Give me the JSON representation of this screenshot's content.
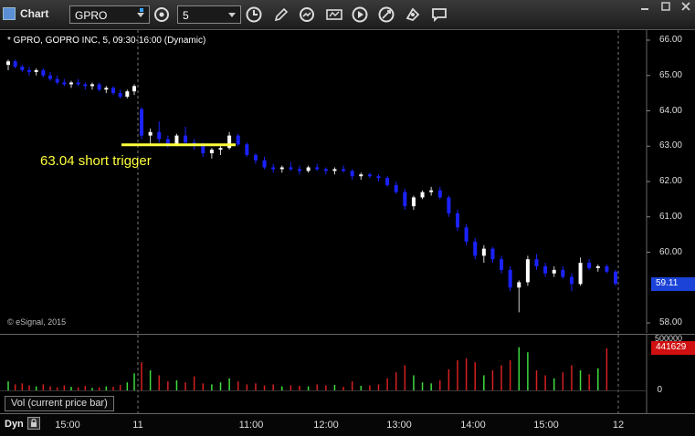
{
  "toolbar": {
    "title": "Chart",
    "symbol": "GPRO",
    "interval": "5",
    "icons": [
      "link-settings-icon",
      "time-icon",
      "draw-pencil-icon",
      "refresh-icon",
      "study-icon",
      "play-icon",
      "tools-icon",
      "shapes-icon",
      "comment-icon"
    ],
    "window_icons": [
      "minimize-icon",
      "maximize-icon",
      "close-icon"
    ]
  },
  "chart": {
    "header": "* GPRO, GOPRO INC, 5, 09:30-16:00 (Dynamic)",
    "annotation": "63.04 short trigger",
    "copyright": "© eSignal, 2015",
    "last_price": "59.11",
    "volume_label": "Vol (current price bar)",
    "last_volume": "441629",
    "volume_top_tick": "500000",
    "volume_zero_tick": "0",
    "dyn_label": "Dyn"
  },
  "colors": {
    "up_candle": "#ffffff",
    "down_candle": "#1a22ff",
    "annotation": "#ffff3c",
    "price_badge": "#1c43d8",
    "volume_badge": "#d01010",
    "volume_up": "#3fdc3f",
    "volume_down": "#d42020"
  },
  "chart_data": {
    "type": "candlestick",
    "title": "* GPRO, GOPRO INC, 5, 09:30-16:00 (Dynamic)",
    "y_ticks": [
      "66.00",
      "65.00",
      "64.00",
      "63.00",
      "62.00",
      "61.00",
      "60.00",
      "58.00"
    ],
    "y_tick_values": [
      66,
      65,
      64,
      63,
      62,
      61,
      60,
      58
    ],
    "ylim": [
      57.7,
      66.2
    ],
    "x_ticks": [
      "15:00",
      "11",
      "11:00",
      "12:00",
      "13:00",
      "14:00",
      "15:00",
      "12"
    ],
    "trigger_level": 63.04,
    "last_price": 59.11,
    "volume_ylim": [
      0,
      500000
    ],
    "grid": "dashed vertical day separators",
    "series": [
      {
        "candles": [
          [
            65.3,
            65.45,
            65.15,
            65.4
          ],
          [
            65.4,
            65.45,
            65.2,
            65.25
          ],
          [
            65.25,
            65.3,
            65.1,
            65.15
          ],
          [
            65.15,
            65.25,
            65.0,
            65.1
          ],
          [
            65.1,
            65.2,
            65.0,
            65.15
          ],
          [
            65.15,
            65.2,
            64.95,
            65.0
          ],
          [
            65.0,
            65.1,
            64.85,
            64.9
          ],
          [
            64.9,
            65.0,
            64.75,
            64.8
          ],
          [
            64.8,
            64.9,
            64.7,
            64.75
          ],
          [
            64.75,
            64.85,
            64.65,
            64.8
          ],
          [
            64.8,
            64.9,
            64.7,
            64.75
          ],
          [
            64.75,
            64.8,
            64.6,
            64.7
          ],
          [
            64.7,
            64.8,
            64.6,
            64.75
          ],
          [
            64.75,
            64.8,
            64.55,
            64.6
          ],
          [
            64.6,
            64.7,
            64.5,
            64.65
          ],
          [
            64.65,
            64.7,
            64.45,
            64.5
          ],
          [
            64.5,
            64.6,
            64.35,
            64.4
          ],
          [
            64.4,
            64.6,
            64.35,
            64.55
          ],
          [
            64.55,
            64.75,
            64.45,
            64.7
          ],
          [
            64.05,
            64.1,
            63.2,
            63.3
          ],
          [
            63.3,
            63.5,
            63.05,
            63.4
          ],
          [
            63.4,
            63.7,
            63.1,
            63.2
          ],
          [
            63.2,
            63.3,
            62.95,
            63.05
          ],
          [
            63.05,
            63.35,
            63.0,
            63.3
          ],
          [
            63.3,
            63.55,
            63.05,
            63.1
          ],
          [
            63.1,
            63.2,
            62.9,
            63.0
          ],
          [
            63.0,
            63.1,
            62.7,
            62.8
          ],
          [
            62.8,
            62.95,
            62.65,
            62.9
          ],
          [
            62.9,
            63.0,
            62.75,
            62.95
          ],
          [
            62.95,
            63.4,
            62.9,
            63.3
          ],
          [
            63.3,
            63.35,
            63.0,
            63.05
          ],
          [
            63.05,
            63.1,
            62.7,
            62.75
          ],
          [
            62.75,
            62.8,
            62.5,
            62.6
          ],
          [
            62.6,
            62.7,
            62.35,
            62.4
          ],
          [
            62.4,
            62.5,
            62.25,
            62.35
          ],
          [
            62.35,
            62.45,
            62.25,
            62.4
          ],
          [
            62.4,
            62.55,
            62.3,
            62.35
          ],
          [
            62.35,
            62.45,
            62.2,
            62.3
          ],
          [
            62.3,
            62.45,
            62.25,
            62.4
          ],
          [
            62.4,
            62.5,
            62.3,
            62.35
          ],
          [
            62.35,
            62.4,
            62.2,
            62.3
          ],
          [
            62.3,
            62.4,
            62.2,
            62.35
          ],
          [
            62.35,
            62.45,
            62.25,
            62.3
          ],
          [
            62.3,
            62.35,
            62.05,
            62.15
          ],
          [
            62.15,
            62.25,
            62.05,
            62.2
          ],
          [
            62.2,
            62.25,
            62.1,
            62.15
          ],
          [
            62.15,
            62.2,
            62.0,
            62.1
          ],
          [
            62.1,
            62.15,
            61.85,
            61.9
          ],
          [
            61.9,
            62.0,
            61.65,
            61.7
          ],
          [
            61.7,
            61.8,
            61.2,
            61.3
          ],
          [
            61.3,
            61.6,
            61.2,
            61.55
          ],
          [
            61.55,
            61.75,
            61.5,
            61.7
          ],
          [
            61.7,
            61.85,
            61.6,
            61.75
          ],
          [
            61.75,
            61.85,
            61.5,
            61.55
          ],
          [
            61.55,
            61.6,
            61.0,
            61.1
          ],
          [
            61.1,
            61.2,
            60.6,
            60.7
          ],
          [
            60.7,
            60.8,
            60.2,
            60.3
          ],
          [
            60.3,
            60.4,
            59.8,
            59.9
          ],
          [
            59.9,
            60.2,
            59.7,
            60.1
          ],
          [
            60.1,
            60.15,
            59.7,
            59.8
          ],
          [
            59.8,
            59.9,
            59.4,
            59.5
          ],
          [
            59.5,
            59.6,
            58.9,
            59.0
          ],
          [
            59.0,
            59.2,
            58.3,
            59.15
          ],
          [
            59.15,
            59.9,
            59.05,
            59.8
          ],
          [
            59.8,
            59.95,
            59.5,
            59.6
          ],
          [
            59.6,
            59.7,
            59.3,
            59.4
          ],
          [
            59.4,
            59.6,
            59.3,
            59.5
          ],
          [
            59.5,
            59.6,
            59.25,
            59.3
          ],
          [
            59.3,
            59.4,
            58.9,
            59.1
          ],
          [
            59.1,
            59.85,
            59.05,
            59.7
          ],
          [
            59.7,
            59.8,
            59.5,
            59.55
          ],
          [
            59.55,
            59.65,
            59.45,
            59.6
          ],
          [
            59.6,
            59.65,
            59.4,
            59.45
          ],
          [
            59.45,
            59.5,
            59.05,
            59.11
          ]
        ],
        "volume": [
          90000,
          60000,
          70000,
          50000,
          40000,
          60000,
          40000,
          30000,
          50000,
          35000,
          30000,
          45000,
          25000,
          30000,
          40000,
          35000,
          55000,
          80000,
          170000,
          280000,
          200000,
          150000,
          90000,
          100000,
          80000,
          140000,
          70000,
          60000,
          80000,
          120000,
          90000,
          60000,
          70000,
          50000,
          60000,
          40000,
          50000,
          45000,
          40000,
          60000,
          50000,
          55000,
          35000,
          90000,
          45000,
          50000,
          60000,
          120000,
          180000,
          250000,
          150000,
          80000,
          70000,
          100000,
          210000,
          300000,
          320000,
          280000,
          150000,
          200000,
          250000,
          300000,
          430000,
          380000,
          200000,
          150000,
          120000,
          180000,
          250000,
          200000,
          160000,
          220000,
          420000
        ]
      }
    ]
  }
}
